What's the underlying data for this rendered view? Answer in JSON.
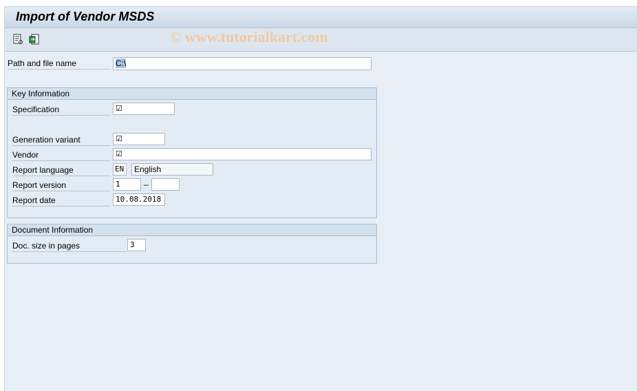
{
  "title": "Import of Vendor MSDS",
  "toolbar": {
    "icons": [
      "execute-document-icon",
      "import-icon"
    ],
    "watermark": "© www.tutorialkart.com"
  },
  "path": {
    "label": "Path and file name",
    "value": "C:\\"
  },
  "key_info": {
    "title": "Key Information",
    "specification": {
      "label": "Specification",
      "value": "☑"
    },
    "generation_variant": {
      "label": "Generation variant",
      "value": "☑"
    },
    "vendor": {
      "label": "Vendor",
      "value": "☑"
    },
    "report_language": {
      "label": "Report language",
      "code": "EN",
      "text": "English"
    },
    "report_version": {
      "label": "Report version",
      "from": "1",
      "separator": "–",
      "to": ""
    },
    "report_date": {
      "label": "Report date",
      "value": "10.08.2018"
    }
  },
  "doc_info": {
    "title": "Document Information",
    "doc_size": {
      "label": "Doc. size in pages",
      "value": "3"
    }
  }
}
